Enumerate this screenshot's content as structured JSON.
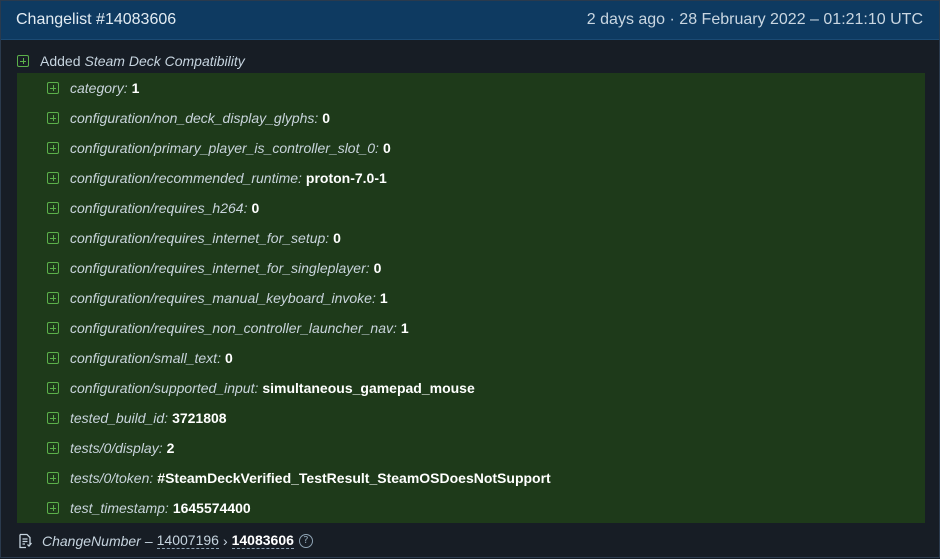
{
  "header": {
    "title": "Changelist #14083606",
    "meta": "2 days ago · 28 February 2022 – 01:21:10 UTC"
  },
  "added": {
    "prefix": "Added",
    "name": "Steam Deck Compatibility"
  },
  "items": [
    {
      "key": "category:",
      "value": "1"
    },
    {
      "key": "configuration/non_deck_display_glyphs:",
      "value": "0"
    },
    {
      "key": "configuration/primary_player_is_controller_slot_0:",
      "value": "0"
    },
    {
      "key": "configuration/recommended_runtime:",
      "value": "proton-7.0-1"
    },
    {
      "key": "configuration/requires_h264:",
      "value": "0"
    },
    {
      "key": "configuration/requires_internet_for_setup:",
      "value": "0"
    },
    {
      "key": "configuration/requires_internet_for_singleplayer:",
      "value": "0"
    },
    {
      "key": "configuration/requires_manual_keyboard_invoke:",
      "value": "1"
    },
    {
      "key": "configuration/requires_non_controller_launcher_nav:",
      "value": "1"
    },
    {
      "key": "configuration/small_text:",
      "value": "0"
    },
    {
      "key": "configuration/supported_input:",
      "value": "simultaneous_gamepad_mouse"
    },
    {
      "key": "tested_build_id:",
      "value": "3721808"
    },
    {
      "key": "tests/0/display:",
      "value": "2"
    },
    {
      "key": "tests/0/token:",
      "value": "#SteamDeckVerified_TestResult_SteamOSDoesNotSupport"
    },
    {
      "key": "test_timestamp:",
      "value": "1645574400"
    }
  ],
  "footer": {
    "label": "ChangeNumber",
    "separator": "–",
    "previous": "14007196",
    "arrow": "›",
    "current": "14083606",
    "help": "?"
  },
  "colors": {
    "header_bg": "#0e3a61",
    "added_bg": "#1e3a1a",
    "plus_icon": "#5bb04a"
  },
  "icons": {
    "add": "plus-square-icon",
    "document": "document-icon",
    "help": "question-circle-icon"
  }
}
